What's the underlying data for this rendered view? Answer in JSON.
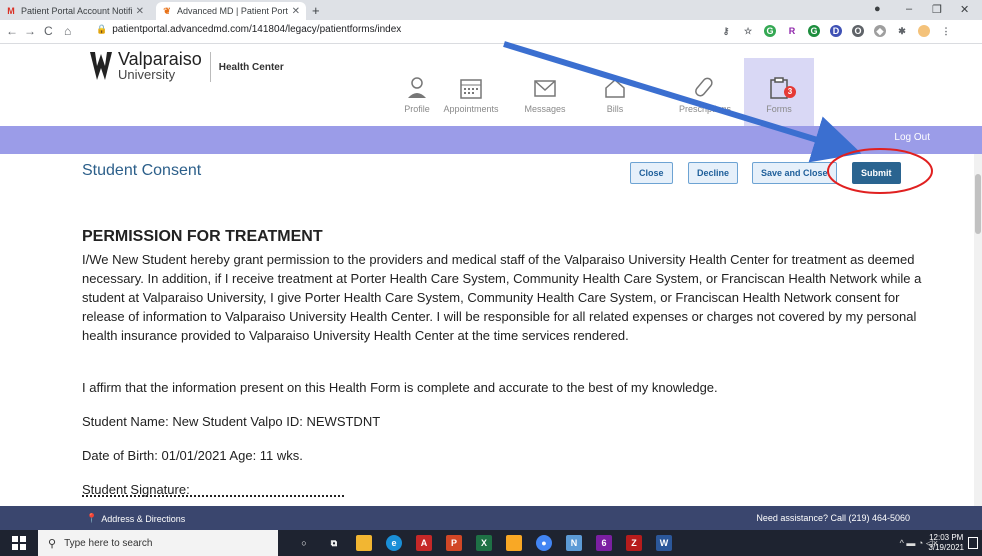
{
  "browser": {
    "tabs": [
      {
        "title": "Patient Portal Account Notificatio",
        "favicon": "gmail-icon",
        "active": false
      },
      {
        "title": "Advanced MD | Patient Portal",
        "favicon": "advancedmd-icon",
        "active": true
      }
    ],
    "new_tab": "+",
    "url": "patientportal.advancedmd.com/141804/legacy/patientforms/index"
  },
  "header": {
    "logo_name": "Valparaiso",
    "logo_sub": "University",
    "logo_dept": "Health Center",
    "nav": [
      {
        "label": "Profile",
        "icon": "person-icon"
      },
      {
        "label": "Appointments",
        "icon": "calendar-icon"
      },
      {
        "label": "Messages",
        "icon": "envelope-icon"
      },
      {
        "label": "Bills",
        "icon": "house-icon"
      },
      {
        "label": "Prescriptions",
        "icon": "pill-icon"
      },
      {
        "label": "Forms",
        "icon": "clipboard-icon",
        "badge": "3",
        "active": true
      }
    ]
  },
  "topbar": {
    "logout": "Log Out"
  },
  "form": {
    "title": "Student Consent",
    "buttons": {
      "close": "Close",
      "decline": "Decline",
      "save_close": "Save and Close",
      "submit": "Submit"
    },
    "heading": "PERMISSION FOR TREATMENT",
    "paragraph": "I/We New Student  hereby grant permission to the providers and medical staff of the Valparaiso University Health Center for treatment as deemed necessary. In addition, if I receive treatment at Porter Health Care System, Community Health Care System, or Franciscan Health Network while a student at Valparaiso University, I give Porter Health Care System, Community Health Care System, or Franciscan Health Network consent for release of information to Valparaiso University Health Center. I will be responsible for all related expenses or charges not covered by my personal health insurance provided to Valparaiso University Health Center at the time services rendered.",
    "affirm": "I affirm that the information present on this Health Form is complete and accurate to the best of my knowledge.",
    "student_name": "Student Name: New Student   Valpo ID: NEWSTDNT",
    "dob": "Date of Birth: 01/01/2021 Age: 11 wks.",
    "signature_label": "Student Signature:"
  },
  "footer": {
    "address": "Address & Directions",
    "assistance": "Need assistance? Call (219) 464-5060"
  },
  "taskbar": {
    "search_placeholder": "Type here to search",
    "time": "12:03 PM",
    "date": "3/19/2021"
  },
  "colors": {
    "purple_bar": "#9b9ce8",
    "submit_bg": "#2a6490",
    "footer_bg": "#3a466e",
    "title_blue": "#2c5f8a",
    "annotation_arrow": "#3b6fd0",
    "annotation_circle": "#e02020"
  }
}
